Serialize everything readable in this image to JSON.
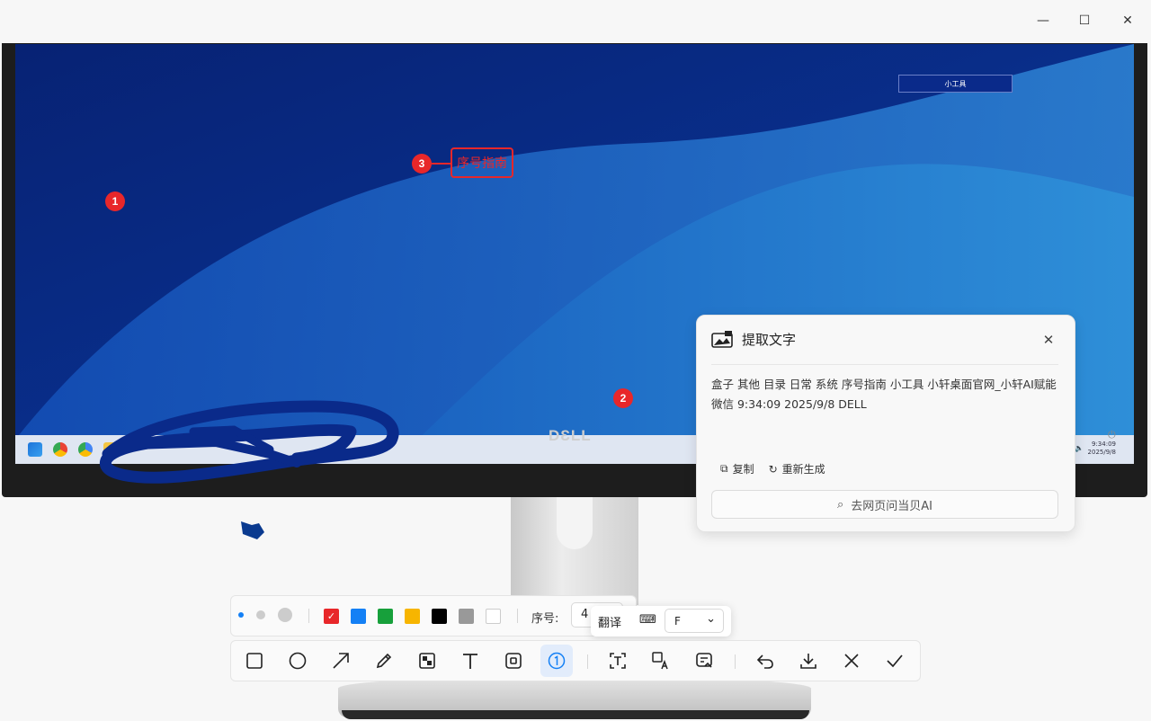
{
  "window": {
    "controls": {
      "minimize": "—",
      "maximize": "☐",
      "close": "✕"
    }
  },
  "desktop": {
    "label_box": "小工具",
    "tray_time": "9:34:09",
    "tray_date": "2025/9/8",
    "monitor_brand": "DƐLL"
  },
  "annotations": {
    "markers": [
      "1",
      "2",
      "3"
    ],
    "text_box": "序号指南",
    "colors": {
      "marker": "#e8272a",
      "pen": "#0a2a8a"
    }
  },
  "ocr_panel": {
    "title": "提取文字",
    "close_icon": "close-icon",
    "text": "盒子 其他 目录 日常 系统 序号指南 小工具 小轩桌面官网_小轩AI赋能 微信 9:34:09 2025/9/8 DELL",
    "copy_label": "复制",
    "regenerate_label": "重新生成",
    "ask_ai_label": "去网页问当贝AI"
  },
  "style_bar": {
    "sizes": [
      "small",
      "medium",
      "large"
    ],
    "selected_size": "small",
    "colors": [
      "#e8272a",
      "#1480f5",
      "#17a03b",
      "#f7b500",
      "#000000",
      "#999999",
      "#ffffff"
    ],
    "selected_color": "#e8272a",
    "seq_label": "序号:",
    "seq_value": "4"
  },
  "translate_popup": {
    "label": "翻译",
    "keyboard_icon": "keyboard-icon",
    "selected_lang": "F",
    "dropdown_icon": "chevron-down-icon"
  },
  "toolbar": {
    "tools": [
      "rectangle",
      "ellipse",
      "arrow",
      "pen",
      "mosaic",
      "text",
      "eraser",
      "serial-number",
      "ocr",
      "translate",
      "summary",
      "undo",
      "download",
      "cancel",
      "confirm"
    ],
    "active_tool": "serial-number"
  }
}
